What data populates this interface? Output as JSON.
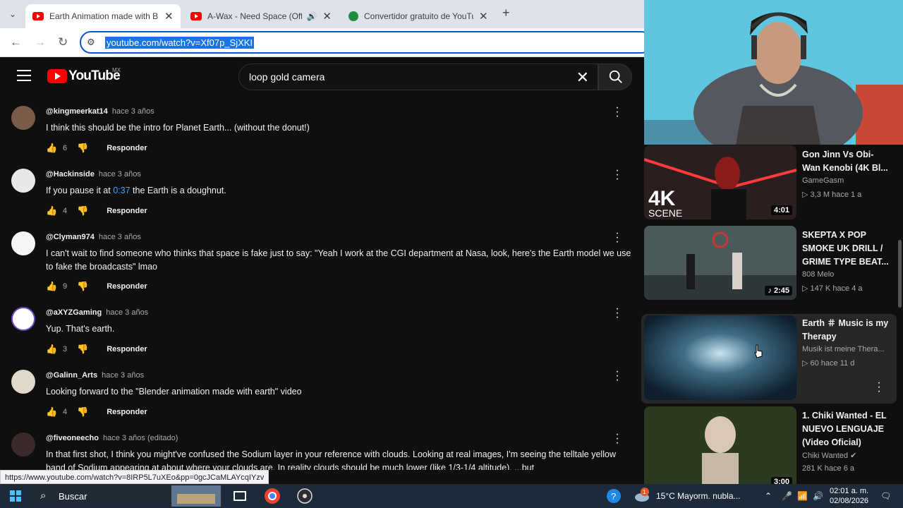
{
  "browser": {
    "tabs": [
      {
        "title": "Earth Animation made with Blender",
        "active": true
      },
      {
        "title": "A-Wax - Need Space (Official",
        "active": false
      },
      {
        "title": "Convertidor gratuito de YouTube",
        "active": false
      }
    ],
    "url": "youtube.com/watch?v=Xf07p_SjXKI",
    "hover_url": "https://www.youtube.com/watch?v=8IRP5L7uXEo&pp=0gcJCaMLAYcqIYzv"
  },
  "youtube": {
    "logo": "YouTube",
    "country_code": "MX",
    "search_query": "loop gold camera"
  },
  "comments": [
    {
      "author": "@kingmeerkat14",
      "time": "hace 3 años",
      "text": "I think this should be the intro for Planet Earth... (without the donut!)",
      "likes": "6",
      "reply": "Responder"
    },
    {
      "author": "@Hackinside",
      "time": "hace 3 años",
      "text_before": "If you pause it at ",
      "timestamp": "0:37",
      "text_after": " the Earth is a doughnut.",
      "likes": "4",
      "reply": "Responder"
    },
    {
      "author": "@Clyman974",
      "time": "hace 3 años",
      "text": "I can't wait to find someone who thinks that space is fake just to say: \"Yeah I work at the CGI department at Nasa, look, here's the Earth model we use to fake the broadcasts\" lmao",
      "likes": "9",
      "reply": "Responder"
    },
    {
      "author": "@aXYZGaming",
      "time": "hace 3 años",
      "text": "Yup. That's earth.",
      "likes": "3",
      "reply": "Responder"
    },
    {
      "author": "@Galinn_Arts",
      "time": "hace 3 años",
      "text": "Looking forward to the \"Blender animation made with earth\" video",
      "likes": "4",
      "reply": "Responder"
    },
    {
      "author": "@fiveoneecho",
      "time": "hace 3 años (editado)",
      "text": "In that first shot, I think you might've confused the Sodium layer in your reference with clouds.  Looking at real images, I'm seeing the telltale yellow band of Sodium appearing at about where your clouds are.  In reality clouds should be much lower (like 1/3-1/4 altitude).  ...but"
    }
  ],
  "recommendations": [
    {
      "title": "Gon Jinn Vs Obi-Wan Kenobi (4K Bl...",
      "channel": "GameGasm",
      "meta": "▷ 3,3 M  hace 1 a",
      "duration": "4:01",
      "thumb_text": "4K",
      "thumb_sub": "SCENE"
    },
    {
      "title": "SKEPTA X POP SMOKE UK DRILL / GRIME TYPE BEAT...",
      "channel": "808 Melo",
      "meta": "▷ 147 K  hace 4 a",
      "duration": "♪ 2:45"
    },
    {
      "title": "Earth ＃ Music is my Therapy",
      "channel": "Musik ist meine Thera...",
      "meta": "▷ 60  hace 11 d"
    },
    {
      "title": "1. Chiki Wanted - EL NUEVO LENGUAJE (Video Oficial)",
      "channel": "Chiki Wanted",
      "meta": "281 K  hace 6 a",
      "duration": "3:00"
    }
  ],
  "taskbar": {
    "search_label": "Buscar",
    "weather": "15°C  Mayorm. nubla...",
    "time": "02:01 a. m.",
    "date": "02/08/2026",
    "badge": "1"
  },
  "colors": {
    "youtube_red": "#ff0000",
    "link_blue": "#3ea6ff",
    "accent": "#0b57d0"
  }
}
